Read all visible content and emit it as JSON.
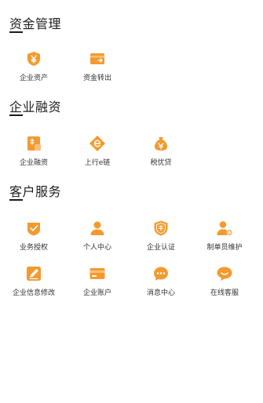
{
  "sections": [
    {
      "title": "资金管理",
      "items": [
        {
          "label": "企业资产",
          "icon": "yen-shield-icon"
        },
        {
          "label": "资金转出",
          "icon": "transfer-card-icon"
        }
      ]
    },
    {
      "title": "企业融资",
      "items": [
        {
          "label": "企业融资",
          "icon": "finance-doc-icon"
        },
        {
          "label": "上行e链",
          "icon": "e-chain-diamond-icon"
        },
        {
          "label": "税优贷",
          "icon": "loan-bag-icon"
        }
      ]
    },
    {
      "title": "客户服务",
      "items": [
        {
          "label": "业务授权",
          "icon": "authorize-check-icon"
        },
        {
          "label": "个人中心",
          "icon": "person-icon"
        },
        {
          "label": "企业认证",
          "icon": "certification-shield-icon"
        },
        {
          "label": "制单员维护",
          "icon": "operator-settings-icon"
        },
        {
          "label": "企业信息修改",
          "icon": "edit-icon"
        },
        {
          "label": "企业账户",
          "icon": "account-card-icon"
        },
        {
          "label": "消息中心",
          "icon": "message-icon"
        },
        {
          "label": "在线客服",
          "icon": "chat-heart-icon"
        }
      ]
    }
  ],
  "colors": {
    "accent": "#f39a2e",
    "accent_light": "#f8bf7a",
    "text": "#333333",
    "title": "#1e1e1e"
  }
}
